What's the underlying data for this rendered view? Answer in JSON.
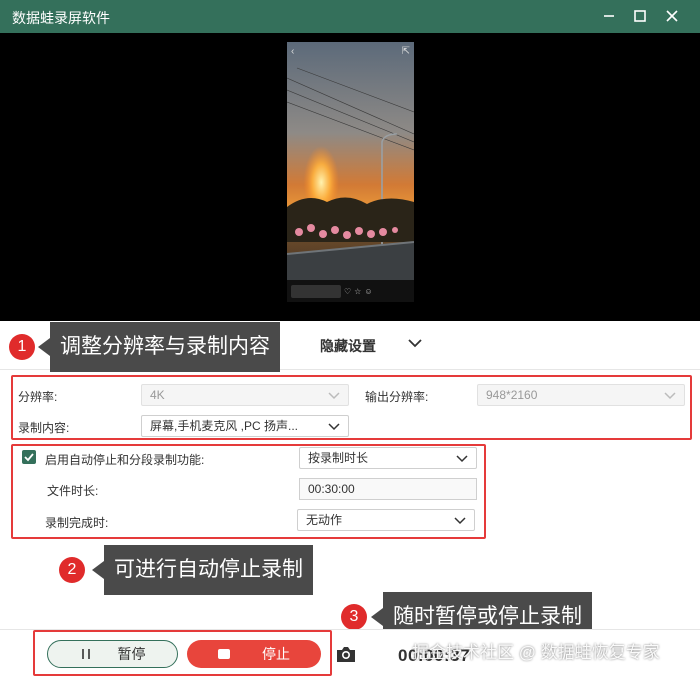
{
  "window": {
    "title": "数据蛙录屏软件",
    "controls": [
      "minimize-icon",
      "maximize-icon",
      "close-icon"
    ]
  },
  "settings_bar": {
    "hidden_settings": "隐藏设置"
  },
  "resolution_group": {
    "resolution_label": "分辨率:",
    "resolution_value": "4K",
    "content_label": "录制内容:",
    "content_value": "屏幕,手机麦克风 ,PC 扬声...",
    "output_label": "输出分辨率:",
    "output_value": "948*2160"
  },
  "auto_stop_group": {
    "enable_label": "启用自动停止和分段录制功能:",
    "enable_checked": true,
    "mode_value": "按录制时长",
    "duration_label": "文件时长:",
    "duration_value": "00:30:00",
    "on_complete_label": "录制完成时:",
    "on_complete_value": "无动作"
  },
  "annotations": [
    {
      "number": "1",
      "text": "调整分辨率与录制内容"
    },
    {
      "number": "2",
      "text": "可进行自动停止录制"
    },
    {
      "number": "3",
      "text": "随时暂停或停止录制"
    }
  ],
  "controls_bar": {
    "pause_label": "暂停",
    "stop_label": "停止",
    "timer": "00:00:37",
    "watermark": "掘金技术社区 @ 数据蛙恢复专家"
  },
  "colors": {
    "brand": "#34705b",
    "annotation_red": "#e53a3a",
    "stop_button": "#e8453c",
    "callout_bg": "#4a4a4a"
  }
}
